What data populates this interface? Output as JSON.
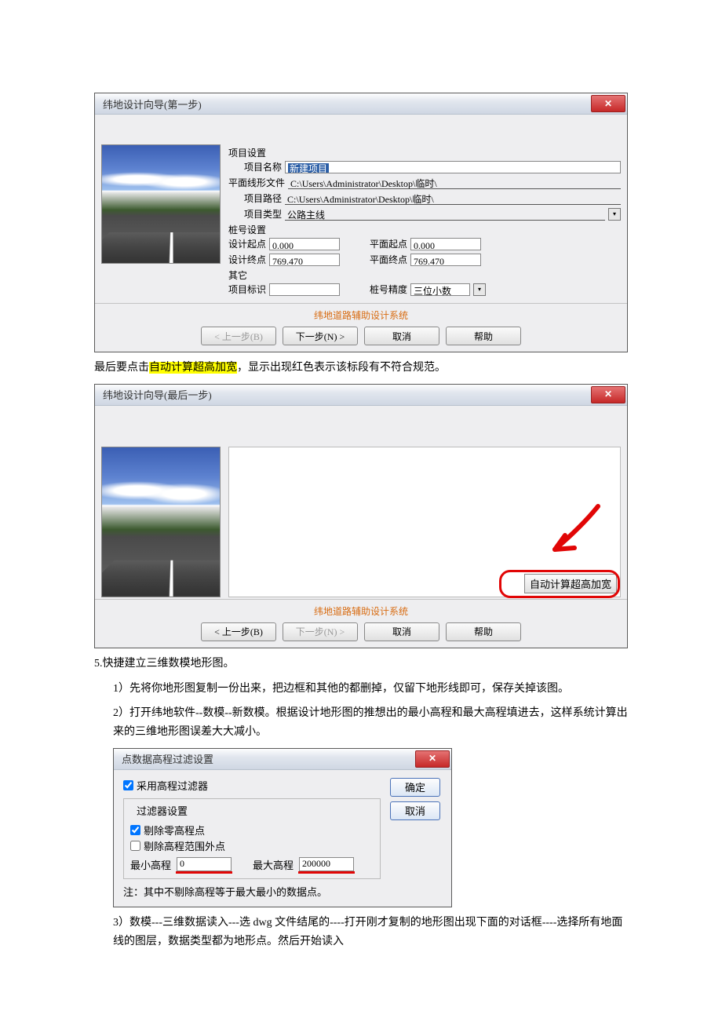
{
  "dialog1": {
    "title": "纬地设计向导(第一步)",
    "close": "✕",
    "sections": {
      "proj": "项目设置",
      "stake": "桩号设置",
      "other": "其它"
    },
    "labels": {
      "proj_name": "项目名称",
      "line_file": "平面线形文件",
      "proj_path": "项目路径",
      "proj_type": "项目类型",
      "design_start": "设计起点",
      "design_end": "设计终点",
      "plane_start": "平面起点",
      "plane_end": "平面终点",
      "proj_id": "项目标识",
      "stake_prec": "桩号精度"
    },
    "values": {
      "proj_name": "新建项目",
      "line_file": "C:\\Users\\Administrator\\Desktop\\临时\\",
      "proj_path": "C:\\Users\\Administrator\\Desktop\\临时\\",
      "proj_type": "公路主线",
      "design_start": "0.000",
      "design_end": "769.470",
      "plane_start": "0.000",
      "plane_end": "769.470",
      "proj_id": "",
      "stake_prec": "三位小数"
    },
    "footer_title": "纬地道路辅助设计系统",
    "buttons": {
      "back": "< 上一步(B)",
      "next": "下一步(N) >",
      "cancel": "取消",
      "help": "帮助"
    }
  },
  "para1": {
    "pre": "最后要点击",
    "hl": "自动计算超高加宽",
    "post": "，显示出现红色表示该标段有不符合规范。"
  },
  "dialog2": {
    "title": "纬地设计向导(最后一步)",
    "close": "✕",
    "auto_btn": "自动计算超高加宽",
    "footer_title": "纬地道路辅助设计系统",
    "buttons": {
      "back": "< 上一步(B)",
      "next": "下一步(N) >",
      "cancel": "取消",
      "help": "帮助"
    }
  },
  "section5": {
    "heading": "5.快捷建立三维数模地形图。",
    "p1": "1）先将你地形图复制一份出来，把边框和其他的都删掉，仅留下地形线即可，保存关掉该图。",
    "p2": "2）打开纬地软件--数模--新数模。根据设计地形图的推想出的最小高程和最大高程填进去，这样系统计算出来的三维地形图误差大大减小。",
    "p3": "3）数模---三维数据读入---选 dwg 文件结尾的----打开刚才复制的地形图出现下面的对话框----选择所有地面线的图层，数据类型都为地形点。然后开始读入"
  },
  "dialog3": {
    "title": "点数据高程过滤设置",
    "close": "✕",
    "use_filter": "采用高程过滤器",
    "group_title": "过滤器设置",
    "remove_zero": "剔除零高程点",
    "remove_range": "剔除高程范围外点",
    "min_label": "最小高程",
    "max_label": "最大高程",
    "min_value": "0",
    "max_value": "200000",
    "note": "注：其中不剔除高程等于最大最小的数据点。",
    "ok": "确定",
    "cancel": "取消"
  }
}
